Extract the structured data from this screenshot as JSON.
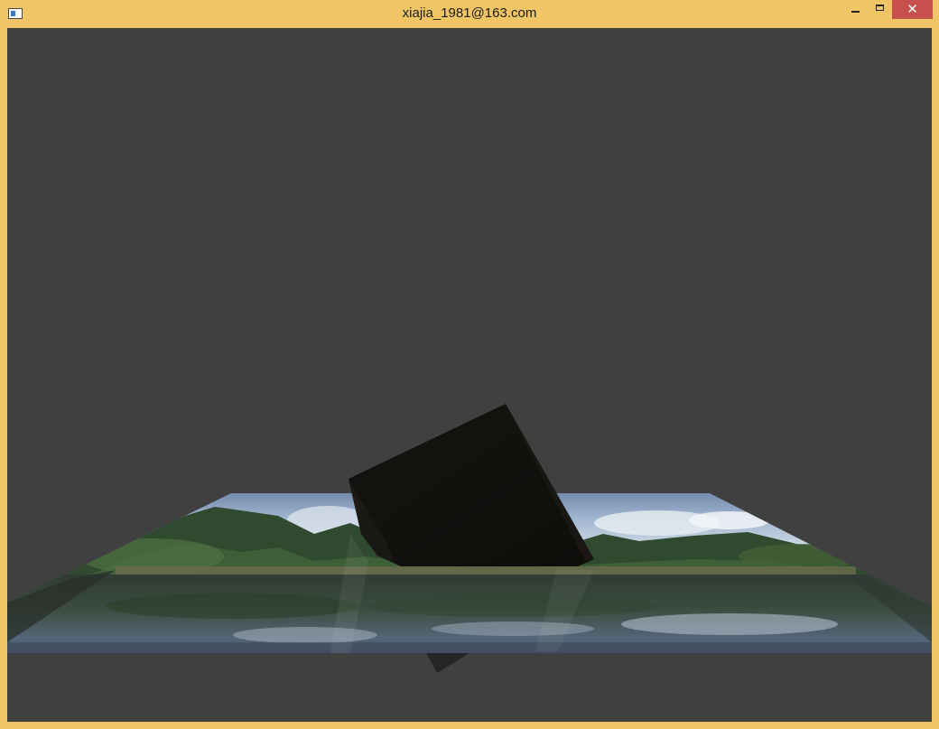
{
  "window": {
    "title": "xiajia_1981@163.com",
    "icons": {
      "app": "app-window-icon",
      "minimize": "minimize-icon",
      "maximize": "maximize-icon",
      "close": "close-icon"
    },
    "close_glyph": "✕"
  },
  "colors": {
    "frame": "#f0c566",
    "viewport_background": "#404040",
    "close_button": "#c7504d",
    "cube": "#141210"
  },
  "scene": {
    "objects": [
      "textured-ground-plane",
      "dark-cube"
    ]
  }
}
